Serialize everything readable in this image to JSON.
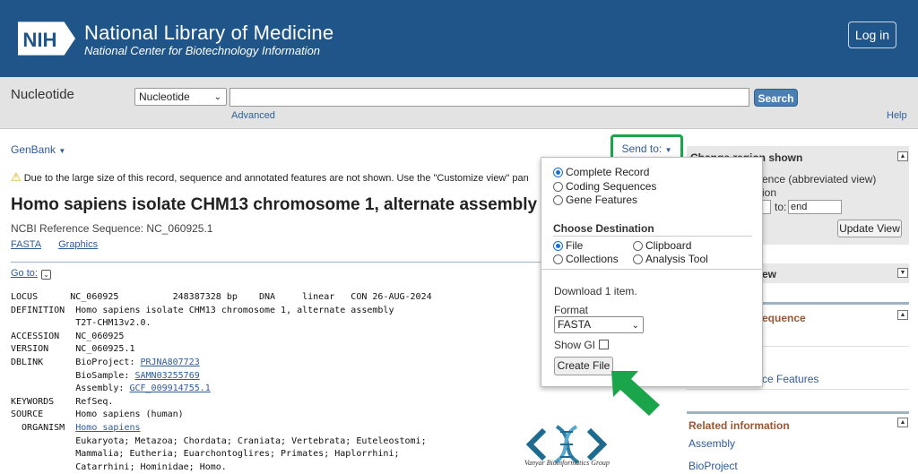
{
  "header": {
    "logo_text": "NIH",
    "title": "National Library of Medicine",
    "subtitle": "National Center for Biotechnology Information",
    "login_label": "Log in"
  },
  "search": {
    "db_name": "Nucleotide",
    "db_selected": "Nucleotide",
    "query": "",
    "button_label": "Search",
    "advanced_label": "Advanced",
    "help_label": "Help"
  },
  "record": {
    "format_menu": "GenBank",
    "warning": "Due to the large size of this record, sequence and annotated features are not shown. Use the \"Customize view\" pan",
    "title": "Homo sapiens isolate CHM13 chromosome 1, alternate assembly",
    "refseq": "NCBI Reference Sequence: NC_060925.1",
    "links": [
      "FASTA",
      "Graphics"
    ],
    "goto_label": "Go to:",
    "fields": {
      "locus_key": "LOCUS",
      "locus_val": "NC_060925          248387328 bp    DNA     linear   CON 26-AUG-2024",
      "definition_key": "DEFINITION",
      "definition_val1": "Homo sapiens isolate CHM13 chromosome 1, alternate assembly",
      "definition_val2": "T2T-CHM13v2.0.",
      "accession_key": "ACCESSION",
      "accession_val": "NC_060925",
      "version_key": "VERSION",
      "version_val": "NC_060925.1",
      "dblink_key": "DBLINK",
      "bioproject_label": "BioProject: ",
      "bioproject_val": "PRJNA807723",
      "biosample_label": "BioSample: ",
      "biosample_val": "SAMN03255769",
      "assembly_label": "Assembly: ",
      "assembly_val": "GCF_009914755.1",
      "keywords_key": "KEYWORDS",
      "keywords_val": "RefSeq.",
      "source_key": "SOURCE",
      "source_val": "Homo sapiens (human)",
      "organism_key": "  ORGANISM",
      "organism_val": "Homo sapiens",
      "lineage1": "Eukaryota; Metazoa; Chordata; Craniata; Vertebrata; Euteleostomi;",
      "lineage2": "Mammalia; Eutheria; Euarchontoglires; Primates; Haplorrhini;",
      "lineage3": "Catarrhini; Hominidae; Homo."
    }
  },
  "sendto": {
    "label": "Send to:",
    "options": [
      "Complete Record",
      "Coding Sequences",
      "Gene Features"
    ],
    "destination_heading": "Choose Destination",
    "destinations": [
      "File",
      "Clipboard",
      "Collections",
      "Analysis Tool"
    ],
    "download_text": "Download 1 item.",
    "format_label": "Format",
    "format_value": "FASTA",
    "show_gi_label": "Show GI",
    "create_button": "Create File"
  },
  "sidebar": {
    "change_region_title": "Change region shown",
    "region_text1": "ence (abbreviated view)",
    "region_text2": "ion",
    "to_label": "to:",
    "end_value": "end",
    "update_button": "Update View",
    "section2_title": "ew",
    "section3_title": "equence",
    "features_link": "ce Features",
    "related_title": "Related information",
    "related_links": [
      "Assembly",
      "BioProject"
    ]
  },
  "watermark": {
    "text": "Vanyar Bioinformatics Group"
  },
  "colors": {
    "header_bg": "#20558a",
    "highlight_green": "#1aa54a",
    "link_blue": "#2e5b9a",
    "related_brown": "#985735"
  }
}
